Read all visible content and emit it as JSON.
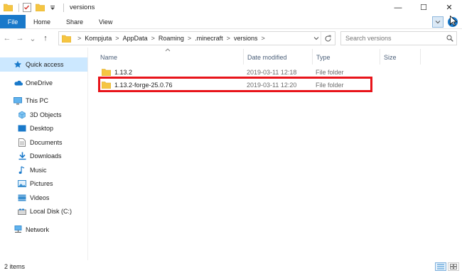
{
  "window": {
    "title": "versions",
    "controls": {
      "minimize": "—",
      "maximize": "☐",
      "close": "✕"
    }
  },
  "ribbon": {
    "file_tab": "File",
    "tabs": [
      "Home",
      "Share",
      "View"
    ]
  },
  "navigation": {
    "back": "←",
    "forward": "→",
    "recent": "⌄",
    "up": "↑"
  },
  "address_bar": {
    "crumbs": [
      "Kompjuta",
      "AppData",
      "Roaming",
      ".minecraft",
      "versions"
    ],
    "separator": ">"
  },
  "search": {
    "placeholder": "Search versions"
  },
  "sidebar": {
    "items": [
      {
        "label": "Quick access",
        "icon": "star-icon",
        "selected": true
      },
      {
        "label": "OneDrive",
        "icon": "cloud-icon"
      },
      {
        "label": "This PC",
        "icon": "computer-icon"
      },
      {
        "label": "3D Objects",
        "icon": "cube-icon"
      },
      {
        "label": "Desktop",
        "icon": "desktop-icon"
      },
      {
        "label": "Documents",
        "icon": "document-icon"
      },
      {
        "label": "Downloads",
        "icon": "download-icon"
      },
      {
        "label": "Music",
        "icon": "music-icon"
      },
      {
        "label": "Pictures",
        "icon": "picture-icon"
      },
      {
        "label": "Videos",
        "icon": "video-icon"
      },
      {
        "label": "Local Disk (C:)",
        "icon": "drive-icon"
      },
      {
        "label": "Network",
        "icon": "network-icon"
      }
    ]
  },
  "columns": [
    "Name",
    "Date modified",
    "Type",
    "Size"
  ],
  "files": [
    {
      "name": "1.13.2",
      "date": "2019-03-11 12:18",
      "type": "File folder",
      "size": ""
    },
    {
      "name": "1.13.2-forge-25.0.76",
      "date": "2019-03-11 12:20",
      "type": "File folder",
      "size": ""
    }
  ],
  "status": {
    "item_count": "2 items"
  },
  "colors": {
    "accent": "#1979ca",
    "selection": "#cce8ff",
    "highlight_box": "#e8141a",
    "folder": "#f5c542"
  }
}
